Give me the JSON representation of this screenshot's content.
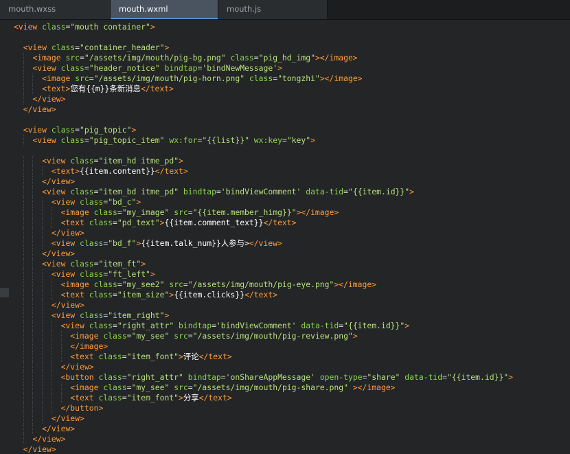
{
  "tabs": [
    {
      "label": "mouth.wxss",
      "active": false
    },
    {
      "label": "mouth.wxml",
      "active": true
    },
    {
      "label": "mouth.js",
      "active": false
    }
  ],
  "colors": {
    "tag": "#ff9d3b",
    "attr": "#8bd649",
    "string": "#b8e07a",
    "text": "#ffffff",
    "background": "#232527",
    "active_tab": "#4a5460"
  },
  "code_lines": [
    [
      [
        "t",
        "<view"
      ],
      [
        "a",
        "class"
      ],
      [
        "e",
        "="
      ],
      [
        "s",
        "\"mouth container\""
      ],
      [
        "t",
        ">"
      ]
    ],
    [],
    [
      [
        "t",
        "<view"
      ],
      [
        "a",
        "class"
      ],
      [
        "e",
        "="
      ],
      [
        "s",
        "\"container_header\""
      ],
      [
        "t",
        ">"
      ]
    ],
    [
      [
        "t",
        "<image"
      ],
      [
        "a",
        "src"
      ],
      [
        "e",
        "="
      ],
      [
        "s",
        "\"/assets/img/mouth/pig-bg.png\""
      ],
      [
        "a",
        "class"
      ],
      [
        "e",
        "="
      ],
      [
        "s",
        "\"pig_hd_img\""
      ],
      [
        "t",
        "></image>"
      ]
    ],
    [
      [
        "t",
        "<view"
      ],
      [
        "a",
        "class"
      ],
      [
        "e",
        "="
      ],
      [
        "s",
        "\"header_notice\""
      ],
      [
        "a",
        "bindtap"
      ],
      [
        "e",
        "="
      ],
      [
        "s",
        "'bindNewMessage'"
      ],
      [
        "t",
        ">"
      ]
    ],
    [
      [
        "t",
        "<image"
      ],
      [
        "a",
        "src"
      ],
      [
        "e",
        "="
      ],
      [
        "s",
        "\"/assets/img/mouth/pig-horn.png\""
      ],
      [
        "a",
        "class"
      ],
      [
        "e",
        "="
      ],
      [
        "s",
        "\"tongzhi\""
      ],
      [
        "t",
        "></image>"
      ]
    ],
    [
      [
        "t",
        "<text>"
      ],
      [
        "x",
        "您有{{m}}条新消息"
      ],
      [
        "t",
        "</text>"
      ]
    ],
    [
      [
        "t",
        "</view>"
      ]
    ],
    [
      [
        "t",
        "</view>"
      ]
    ],
    [],
    [
      [
        "t",
        "<view"
      ],
      [
        "a",
        "class"
      ],
      [
        "e",
        "="
      ],
      [
        "s",
        "\"pig_topic\""
      ],
      [
        "t",
        ">"
      ]
    ],
    [
      [
        "t",
        "<view"
      ],
      [
        "a",
        "class"
      ],
      [
        "e",
        "="
      ],
      [
        "s",
        "\"pig_topic_item\""
      ],
      [
        "a",
        "wx:for"
      ],
      [
        "e",
        "="
      ],
      [
        "s",
        "\"{{list}}\""
      ],
      [
        "a",
        "wx:key"
      ],
      [
        "e",
        "="
      ],
      [
        "s",
        "\"key\""
      ],
      [
        "t",
        ">"
      ]
    ],
    [],
    [
      [
        "t",
        "<view"
      ],
      [
        "a",
        "class"
      ],
      [
        "e",
        "="
      ],
      [
        "s",
        "\"item_hd itme_pd\""
      ],
      [
        "t",
        ">"
      ]
    ],
    [
      [
        "t",
        "<text>"
      ],
      [
        "x",
        "{{item.content}}"
      ],
      [
        "t",
        "</text>"
      ]
    ],
    [
      [
        "t",
        "</view>"
      ]
    ],
    [
      [
        "t",
        "<view"
      ],
      [
        "a",
        "class"
      ],
      [
        "e",
        "="
      ],
      [
        "s",
        "\"item_bd itme_pd\""
      ],
      [
        "a",
        "bindtap"
      ],
      [
        "e",
        "="
      ],
      [
        "s",
        "'bindViewComment'"
      ],
      [
        "a",
        "data-tid"
      ],
      [
        "e",
        "="
      ],
      [
        "s",
        "\"{{item.id}}\""
      ],
      [
        "t",
        ">"
      ]
    ],
    [
      [
        "t",
        "<view"
      ],
      [
        "a",
        "class"
      ],
      [
        "e",
        "="
      ],
      [
        "s",
        "\"bd_c\""
      ],
      [
        "t",
        ">"
      ]
    ],
    [
      [
        "t",
        "<image"
      ],
      [
        "a",
        "class"
      ],
      [
        "e",
        "="
      ],
      [
        "s",
        "\"my_image\""
      ],
      [
        "a",
        "src"
      ],
      [
        "e",
        "="
      ],
      [
        "s",
        "\"{{item.member_himg}}\""
      ],
      [
        "t",
        "></image>"
      ]
    ],
    [
      [
        "t",
        "<text"
      ],
      [
        "a",
        "class"
      ],
      [
        "e",
        "="
      ],
      [
        "s",
        "\"pd_text\""
      ],
      [
        "t",
        ">"
      ],
      [
        "x",
        "{{item.comment_text}}"
      ],
      [
        "t",
        "</text>"
      ]
    ],
    [
      [
        "t",
        "</view>"
      ]
    ],
    [
      [
        "t",
        "<view"
      ],
      [
        "a",
        "class"
      ],
      [
        "e",
        "="
      ],
      [
        "s",
        "\"bd_f\""
      ],
      [
        "t",
        ">"
      ],
      [
        "x",
        "{{item.talk_num}}人参与>"
      ],
      [
        "t",
        "</view>"
      ]
    ],
    [
      [
        "t",
        "</view>"
      ]
    ],
    [
      [
        "t",
        "<view"
      ],
      [
        "a",
        "class"
      ],
      [
        "e",
        "="
      ],
      [
        "s",
        "\"item_ft\""
      ],
      [
        "t",
        ">"
      ]
    ],
    [
      [
        "t",
        "<view"
      ],
      [
        "a",
        "class"
      ],
      [
        "e",
        "="
      ],
      [
        "s",
        "\"ft_left\""
      ],
      [
        "t",
        ">"
      ]
    ],
    [
      [
        "t",
        "<image"
      ],
      [
        "a",
        "class"
      ],
      [
        "e",
        "="
      ],
      [
        "s",
        "\"my_see2\""
      ],
      [
        "a",
        "src"
      ],
      [
        "e",
        "="
      ],
      [
        "s",
        "\"/assets/img/mouth/pig-eye.png\""
      ],
      [
        "t",
        "></image>"
      ]
    ],
    [
      [
        "t",
        "<text"
      ],
      [
        "a",
        "class"
      ],
      [
        "e",
        "="
      ],
      [
        "s",
        "\"item_size\""
      ],
      [
        "t",
        ">"
      ],
      [
        "x",
        "{{item.clicks}}"
      ],
      [
        "t",
        "</text>"
      ]
    ],
    [
      [
        "t",
        "</view>"
      ]
    ],
    [
      [
        "t",
        "<view"
      ],
      [
        "a",
        "class"
      ],
      [
        "e",
        "="
      ],
      [
        "s",
        "\"item_right\""
      ],
      [
        "t",
        ">"
      ]
    ],
    [
      [
        "t",
        "<view"
      ],
      [
        "a",
        "class"
      ],
      [
        "e",
        "="
      ],
      [
        "s",
        "\"right_attr\""
      ],
      [
        "a",
        "bindtap"
      ],
      [
        "e",
        "="
      ],
      [
        "s",
        "'bindViewComment'"
      ],
      [
        "a",
        "data-tid"
      ],
      [
        "e",
        "="
      ],
      [
        "s",
        "\"{{item.id}}\""
      ],
      [
        "t",
        ">"
      ]
    ],
    [
      [
        "t",
        "<image"
      ],
      [
        "a",
        "class"
      ],
      [
        "e",
        "="
      ],
      [
        "s",
        "\"my_see\""
      ],
      [
        "a",
        "src"
      ],
      [
        "e",
        "="
      ],
      [
        "s",
        "\"/assets/img/mouth/pig-review.png\""
      ],
      [
        "t",
        ">"
      ]
    ],
    [
      [
        "t",
        "</image>"
      ]
    ],
    [
      [
        "t",
        "<text"
      ],
      [
        "a",
        "class"
      ],
      [
        "e",
        "="
      ],
      [
        "s",
        "\"item_font\""
      ],
      [
        "t",
        ">"
      ],
      [
        "x",
        "评论"
      ],
      [
        "t",
        "</text>"
      ]
    ],
    [
      [
        "t",
        "</view>"
      ]
    ],
    [
      [
        "t",
        "<button"
      ],
      [
        "a",
        "class"
      ],
      [
        "e",
        "="
      ],
      [
        "s",
        "\"right_attr\""
      ],
      [
        "a",
        "bindtap"
      ],
      [
        "e",
        "="
      ],
      [
        "s",
        "'onShareAppMessage'"
      ],
      [
        "a",
        "open-type"
      ],
      [
        "e",
        "="
      ],
      [
        "s",
        "\"share\""
      ],
      [
        "a",
        "data-tid"
      ],
      [
        "e",
        "="
      ],
      [
        "s",
        "\"{{item.id}}\""
      ],
      [
        "t",
        ">"
      ]
    ],
    [
      [
        "t",
        "<image"
      ],
      [
        "a",
        "class"
      ],
      [
        "e",
        "="
      ],
      [
        "s",
        "\"my_see\""
      ],
      [
        "a",
        "src"
      ],
      [
        "e",
        "="
      ],
      [
        "s",
        "\"/assets/img/mouth/pig-share.png\""
      ],
      [
        "t",
        " ></image>"
      ]
    ],
    [
      [
        "t",
        "<text"
      ],
      [
        "a",
        "class"
      ],
      [
        "e",
        "="
      ],
      [
        "s",
        "\"item_font\""
      ],
      [
        "t",
        ">"
      ],
      [
        "x",
        "分享"
      ],
      [
        "t",
        "</text>"
      ]
    ],
    [
      [
        "t",
        "</button>"
      ]
    ],
    [
      [
        "t",
        "</view>"
      ]
    ],
    [
      [
        "t",
        "</view>"
      ]
    ],
    [
      [
        "t",
        "</view>"
      ]
    ],
    [
      [
        "t",
        "</view>"
      ]
    ]
  ]
}
